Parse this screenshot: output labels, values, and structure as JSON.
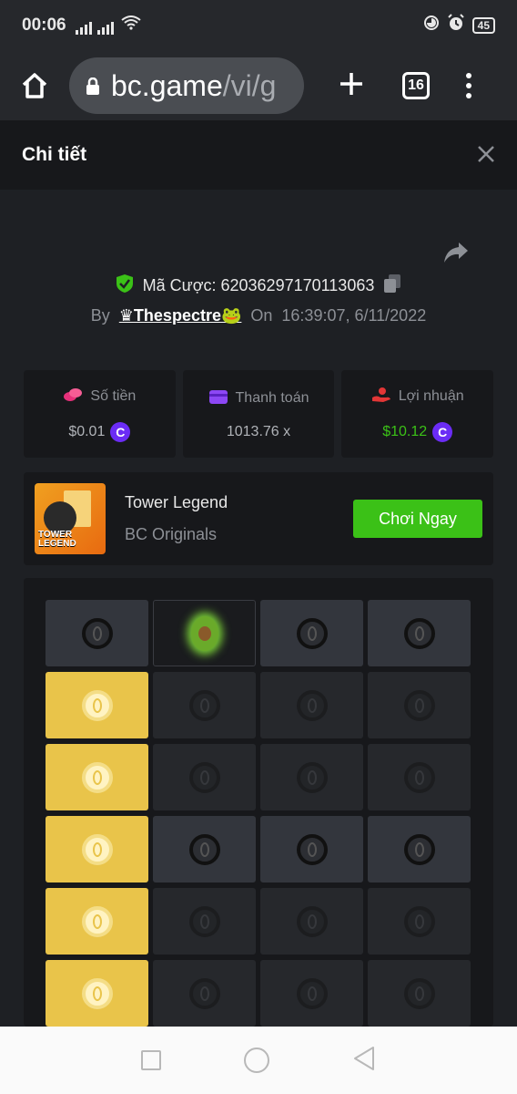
{
  "status_bar": {
    "time": "00:06",
    "battery": "45"
  },
  "browser": {
    "url_domain": "bc.game",
    "url_path": "/vi/g",
    "tab_count": "16"
  },
  "header": {
    "title": "Chi tiết"
  },
  "bet": {
    "id_label": "Mã Cược: 62036297170113063",
    "by_label": "By",
    "user": "♛Thespectre🐸",
    "on_label": "On",
    "timestamp": "16:39:07, 6/11/2022"
  },
  "stats": {
    "amount_label": "Số tiền",
    "amount_value": "$0.01",
    "payout_label": "Thanh toán",
    "payout_value": "1013.76 x",
    "profit_label": "Lợi nhuận",
    "profit_value": "$10.12"
  },
  "game": {
    "name": "Tower Legend",
    "provider": "BC Originals",
    "play_label": "Chơi Ngay",
    "thumb_text": "TOWER LEGEND"
  },
  "colors": {
    "accent_green": "#3bc117",
    "coin_purple": "#6b2cf5",
    "picked_gold": "#e9c44a"
  },
  "board": {
    "rows": [
      [
        "egg-revealed",
        "avocado",
        "egg-revealed",
        "egg-revealed"
      ],
      [
        "picked",
        "dim",
        "dim",
        "dim"
      ],
      [
        "picked",
        "dim",
        "dim",
        "dim"
      ],
      [
        "picked",
        "egg-revealed",
        "egg-revealed",
        "egg-revealed"
      ],
      [
        "picked",
        "dim",
        "dim",
        "dim"
      ],
      [
        "picked",
        "dim",
        "dim",
        "dim"
      ]
    ]
  }
}
